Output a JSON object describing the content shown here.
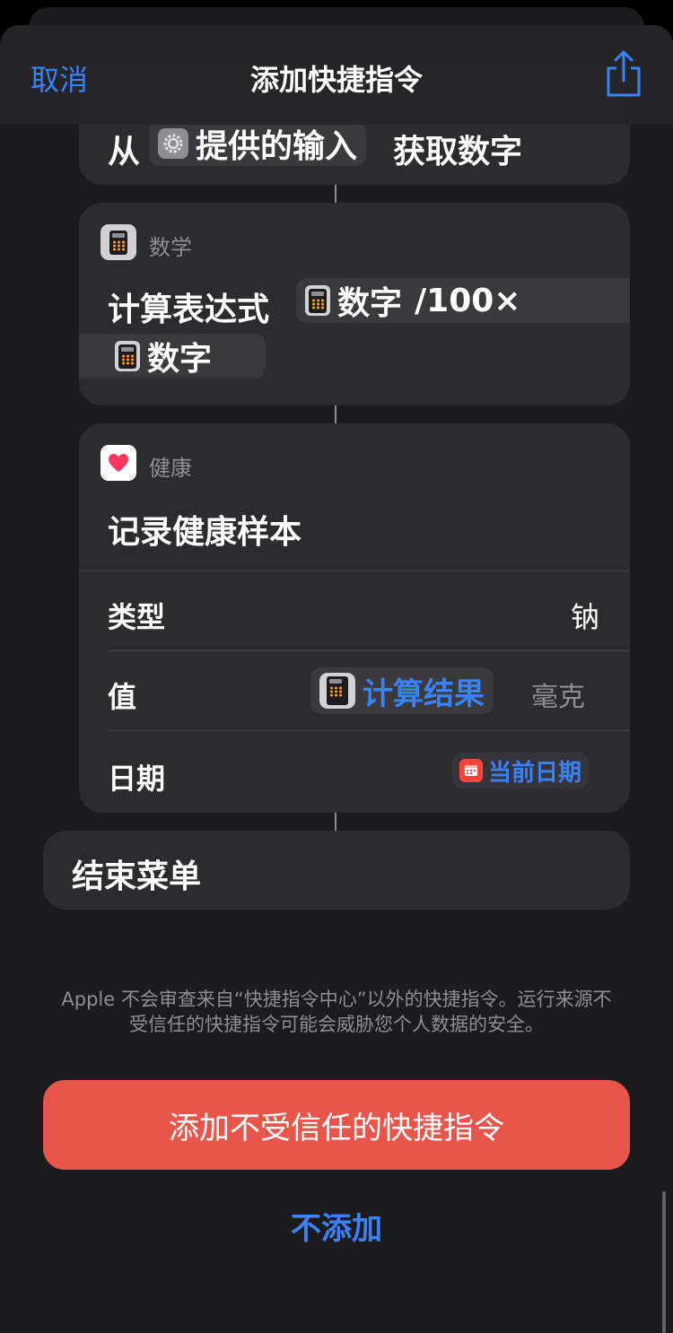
{
  "nav": {
    "cancel_label": "取消",
    "title": "添加快捷指令",
    "share_icon": "share-icon"
  },
  "actions": {
    "get_numbers": {
      "prefix": "从",
      "input_chip": "提供的输入",
      "suffix": "获取数字",
      "input_icon": "gear-icon"
    },
    "calculate": {
      "app_label": "数学",
      "prefix": "计算表达式",
      "var_label": "数字",
      "operator_text": "/100×",
      "var2_label": "数字"
    },
    "health": {
      "app_label": "健康",
      "title": "记录健康样本",
      "type_label": "类型",
      "type_value": "钠",
      "value_label": "值",
      "value_chip": "计算结果",
      "value_unit": "毫克",
      "date_label": "日期",
      "date_chip": "当前日期"
    },
    "end_menu": {
      "label": "结束菜单"
    }
  },
  "footer": {
    "disclaimer_line1": "Apple 不会审查来自“快捷指令中心”以外的快捷指令。运行来源不",
    "disclaimer_line2": "受信任的快捷指令可能会威胁您个人数据的安全。",
    "add_button_label": "添加不受信任的快捷指令",
    "dont_add_label": "不添加"
  },
  "colors": {
    "accent": "#3b82f6",
    "danger": "#e8554a",
    "card": "#2c2c2e",
    "background": "#1c1c1e"
  }
}
